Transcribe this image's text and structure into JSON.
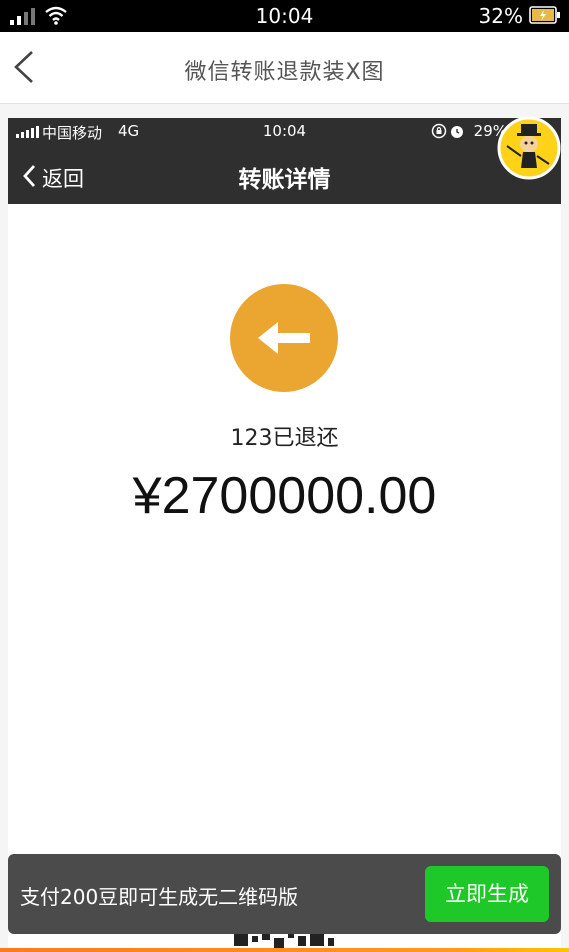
{
  "status_bar": {
    "time": "10:04",
    "battery": "32%"
  },
  "app_header": {
    "title": "微信转账退款装X图"
  },
  "preview": {
    "inner_status": {
      "carrier": "中国移动",
      "network": "4G",
      "time": "10:04",
      "battery": "29%"
    },
    "nav": {
      "back_label": "返回",
      "title": "转账详情"
    },
    "refund_label": "123已退还",
    "amount": "¥2700000.00"
  },
  "banner": {
    "text": "支付200豆即可生成无二维码版",
    "button_label": "立即生成"
  },
  "colors": {
    "accent_orange": "#eaa631",
    "button_green": "#1fc829",
    "nav_dark": "#2f2f2f"
  }
}
